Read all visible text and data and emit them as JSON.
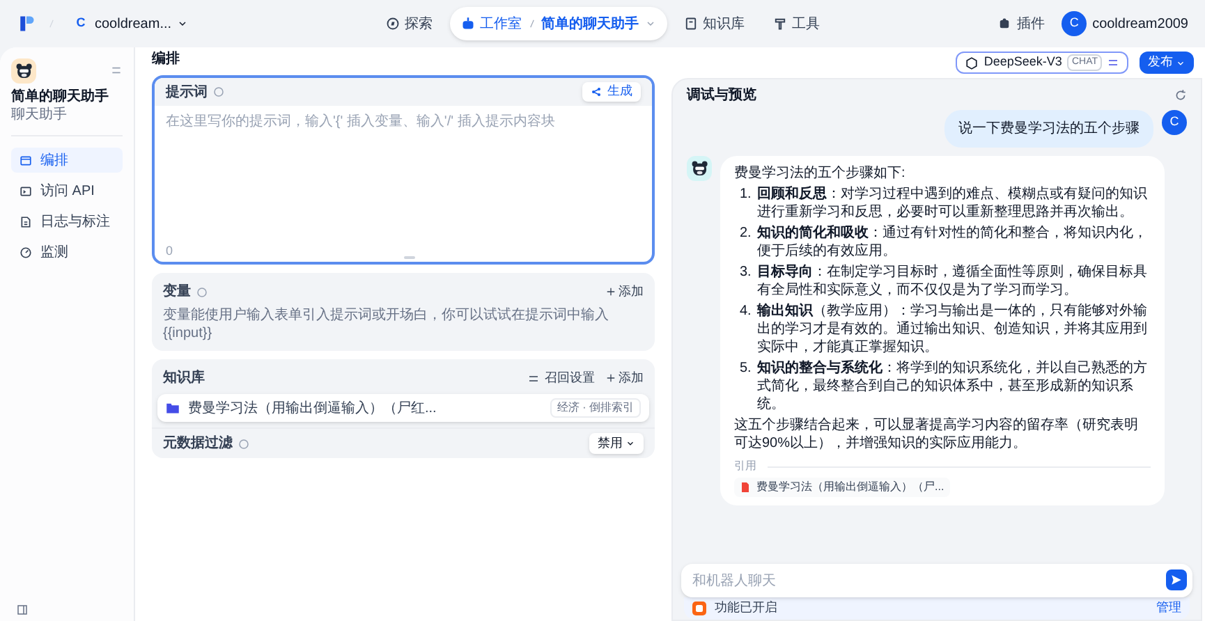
{
  "top_bar": {
    "workspace_initial": "C",
    "workspace": "cooldream...",
    "nav": [
      {
        "kind": "explore",
        "label": "探索",
        "selected": false
      },
      {
        "kind": "studio",
        "label": "工作室",
        "selected": true,
        "app": "简单的聊天助手"
      },
      {
        "kind": "datasets",
        "label": "知识库",
        "selected": false
      },
      {
        "kind": "tools",
        "label": "工具",
        "selected": false
      }
    ],
    "plugins": "插件",
    "user": {
      "avatar": "C",
      "name": "cooldream2009"
    }
  },
  "sidebar": {
    "app_name": "简单的聊天助手",
    "app_type": "聊天助手",
    "items": [
      {
        "kind": "edit",
        "label": "编排",
        "selected": true
      },
      {
        "kind": "api",
        "label": "访问 API",
        "selected": false
      },
      {
        "kind": "logs",
        "label": "日志与标注",
        "selected": false
      },
      {
        "kind": "monitor",
        "label": "监测",
        "selected": false
      }
    ]
  },
  "editor": {
    "title": "编排",
    "model": {
      "name": "DeepSeek-V3",
      "tag": "CHAT"
    },
    "publish": "发布",
    "prompt": {
      "label": "提示词",
      "generate": "生成",
      "placeholder": "在这里写你的提示词，输入'{' 插入变量、输入'/' 插入提示内容块",
      "count": "0"
    },
    "variables": {
      "label": "变量",
      "add": "添加",
      "description": "变量能使用户输入表单引入提示词或开场白，你可以试试在提示词中输入 {{input}}"
    },
    "knowledge": {
      "label": "知识库",
      "recall": "召回设置",
      "add": "添加",
      "items": [
        {
          "name": "费曼学习法（用输出倒逼输入）（尸红...",
          "badge": "经济 · 倒排索引"
        }
      ]
    },
    "metadata": {
      "label": "元数据过滤",
      "value": "禁用"
    }
  },
  "preview": {
    "title": "调试与预览",
    "messages": [
      {
        "kind": "user",
        "avatar": "C",
        "text": "说一下费曼学习法的五个步骤"
      },
      {
        "kind": "assistant",
        "intro": "费曼学习法的五个步骤如下:",
        "steps": [
          {
            "number": "1.",
            "text": "**回顾和反思**：对学习过程中遇到的难点、模糊点或有疑问的知识进行重新学习和反思，必要时可以重新整理思路并再次输出。"
          },
          {
            "number": "2.",
            "text": "**知识的简化和吸收**：通过有针对性的简化和整合，将知识内化，便于后续的有效应用。"
          },
          {
            "number": "3.",
            "text": "**目标导向**：在制定学习目标时，遵循全面性等原则，确保目标具有全局性和实际意义，而不仅仅是为了学习而学习。"
          },
          {
            "number": "4.",
            "text": "**输出知识**（教学应用）：学习与输出是一体的，只有能够对外输出的学习才是有效的。通过输出知识、创造知识，并将其应用到实际中，才能真正掌握知识。"
          },
          {
            "number": "5.",
            "text": "**知识的整合与系统化**：将学到的知识系统化，并以自己熟悉的方式简化，最终整合到自己的知识体系中，甚至形成新的知识系统。"
          }
        ],
        "outro": "这五个步骤结合起来，可以显著提高学习内容的留存率（研究表明可达90%以上），并增强知识的实际应用能力。",
        "citation_label": "引用",
        "citations": [
          "费曼学习法（用输出倒逼输入）（尸..."
        ]
      }
    ],
    "input_placeholder": "和机器人聊天",
    "feature": "功能已开启",
    "manage": "管理"
  }
}
